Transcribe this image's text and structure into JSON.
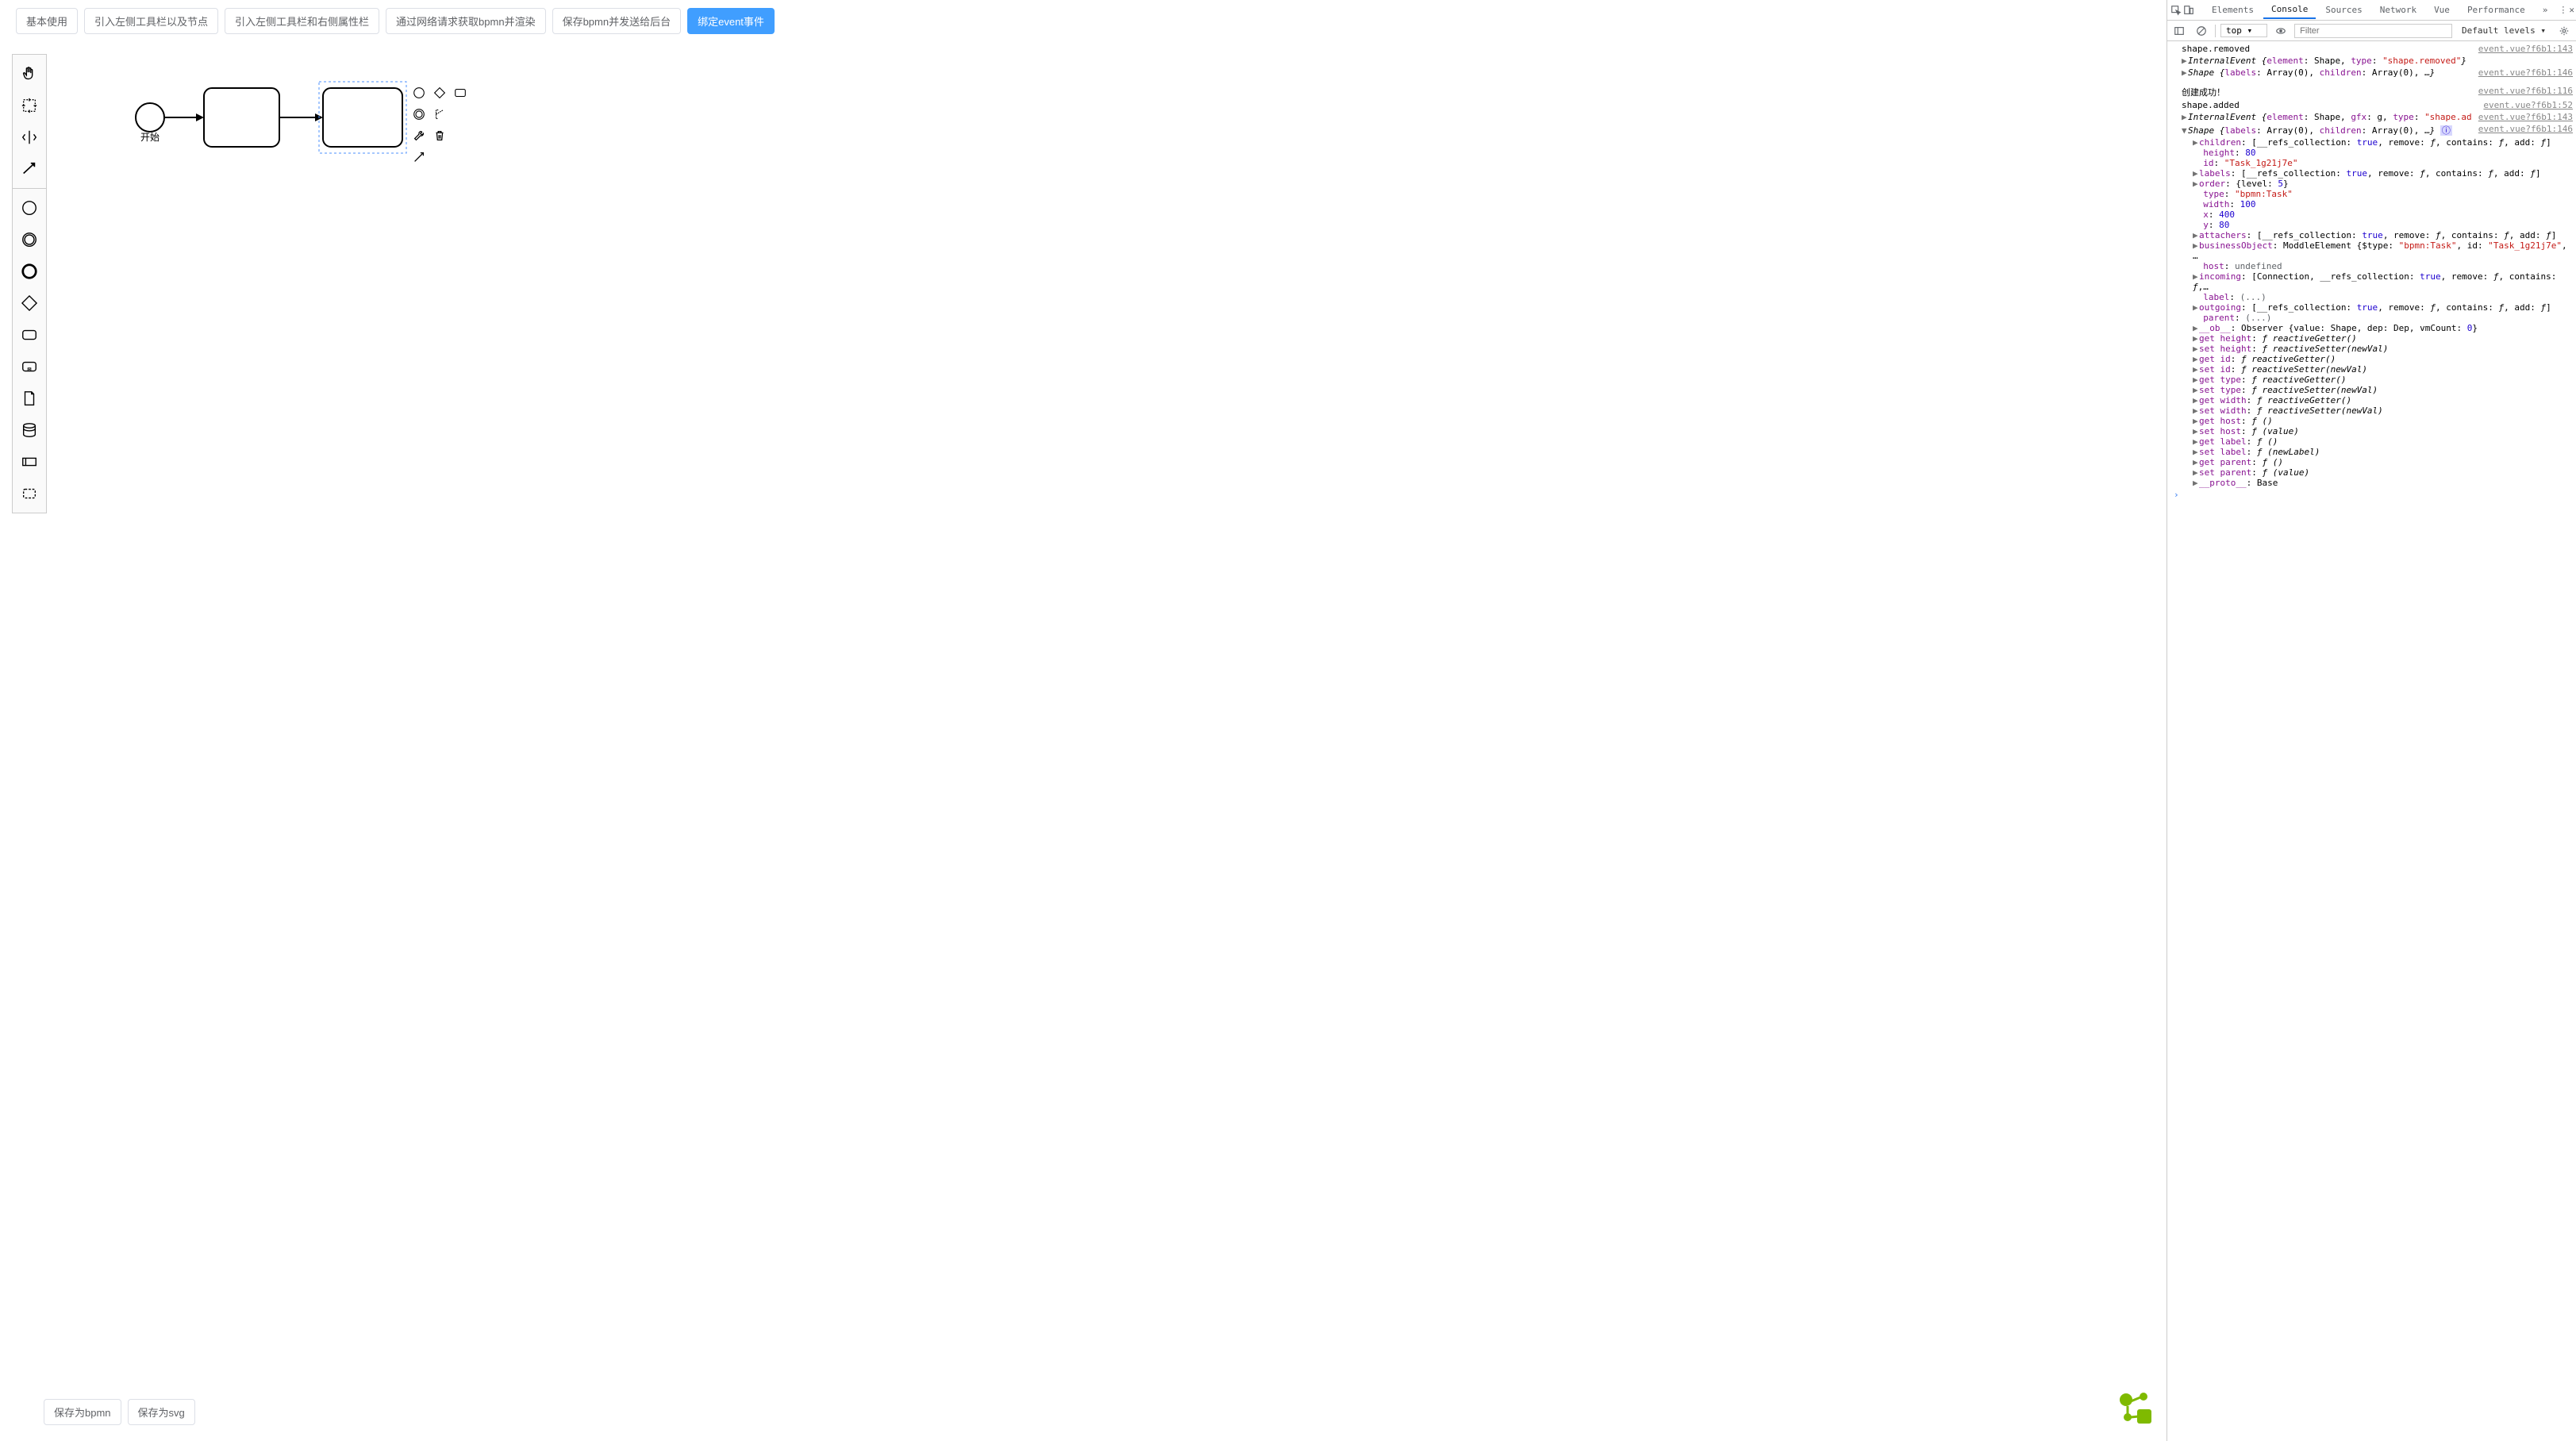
{
  "topButtons": {
    "basic": "基本使用",
    "leftPalette": "引入左侧工具栏以及节点",
    "leftRight": "引入左侧工具栏和右侧属性栏",
    "network": "通过网络请求获取bpmn并渲染",
    "saveSend": "保存bpmn并发送给后台",
    "bindEvent": "绑定event事件"
  },
  "startLabel": "开始",
  "bottomButtons": {
    "saveBpmn": "保存为bpmn",
    "saveSvg": "保存为svg"
  },
  "devtools": {
    "tabs": {
      "elements": "Elements",
      "console": "Console",
      "sources": "Sources",
      "network": "Network",
      "vue": "Vue",
      "performance": "Performance"
    },
    "contextSelect": "top",
    "filterPlaceholder": "Filter",
    "levels": "Default levels",
    "logs": {
      "shapeRemoved": "shape.removed",
      "internalEvent1": "InternalEvent {element: Shape, type: \"shape.removed\"}",
      "shapeLine1": "Shape {labels: Array(0), children: Array(0), …}",
      "createSuccess": "创建成功！",
      "shapeAdded": "shape.added",
      "internalEvent2": "InternalEvent {element: Shape, gfx: g, type: \"shape.added\"}",
      "shapeHeader": "Shape {labels: Array(0), children: Array(0), …}"
    },
    "sources": {
      "s143": "event.vue?f6b1:143",
      "s146": "event.vue?f6b1:146",
      "s116": "event.vue?f6b1:116",
      "s52": "event.vue?f6b1:52"
    },
    "props": {
      "children": "children: [__refs_collection: true, remove: ƒ, contains: ƒ, add: ƒ]",
      "height": "height: 80",
      "id": "id: \"Task_1g21j7e\"",
      "labels": "labels: [__refs_collection: true, remove: ƒ, contains: ƒ, add: ƒ]",
      "order": "order: {level: 5}",
      "type": "type: \"bpmn:Task\"",
      "width": "width: 100",
      "x": "x: 400",
      "y": "y: 80",
      "attachers": "attachers: [__refs_collection: true, remove: ƒ, contains: ƒ, add: ƒ]",
      "businessObject": "businessObject: ModdleElement {$type: \"bpmn:Task\", id: \"Task_1g21j7e\", …",
      "host": "host: undefined",
      "incoming": "incoming: [Connection, __refs_collection: true, remove: ƒ, contains: ƒ,…",
      "label": "label: (...)",
      "outgoing": "outgoing: [__refs_collection: true, remove: ƒ, contains: ƒ, add: ƒ]",
      "parent": "parent: (...)",
      "ob": "__ob__: Observer {value: Shape, dep: Dep, vmCount: 0}",
      "getHeight": "get height: ƒ reactiveGetter()",
      "setHeight": "set height: ƒ reactiveSetter(newVal)",
      "getId": "get id: ƒ reactiveGetter()",
      "setId": "set id: ƒ reactiveSetter(newVal)",
      "getType": "get type: ƒ reactiveGetter()",
      "setType": "set type: ƒ reactiveSetter(newVal)",
      "getWidth": "get width: ƒ reactiveGetter()",
      "setWidth": "set width: ƒ reactiveSetter(newVal)",
      "getHost": "get host: ƒ ()",
      "setHost": "set host: ƒ (value)",
      "getLabel": "get label: ƒ ()",
      "setLabel": "set label: ƒ (newLabel)",
      "getParent": "get parent: ƒ ()",
      "setParent": "set parent: ƒ (value)",
      "proto": "__proto__: Base"
    }
  }
}
